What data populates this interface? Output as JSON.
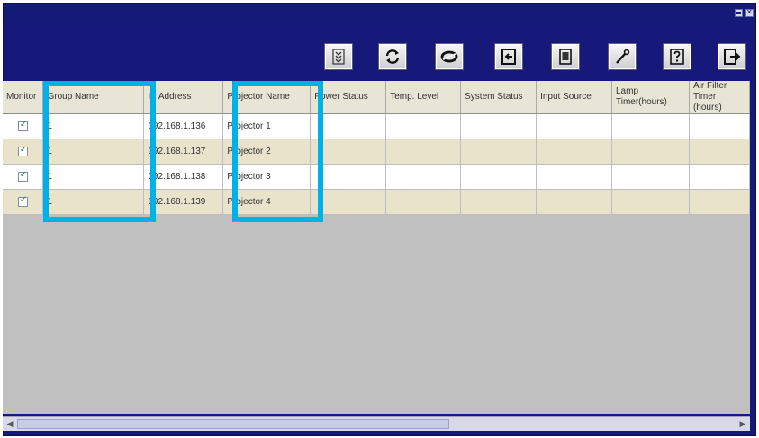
{
  "toolbar": {
    "buttons": [
      {
        "name": "filter-down-icon"
      },
      {
        "name": "refresh-icon"
      },
      {
        "name": "sync-icon"
      },
      {
        "name": "import-icon"
      },
      {
        "name": "save-icon"
      },
      {
        "name": "tool-icon"
      },
      {
        "name": "help-icon"
      },
      {
        "name": "exit-icon"
      }
    ]
  },
  "table": {
    "headers": [
      "Monitor",
      "Group Name",
      "IP Address",
      "Projector Name",
      "Power Status",
      "Temp. Level",
      "System Status",
      "Input Source",
      "Lamp Timer(hours)",
      "Air Filter Timer (hours)"
    ],
    "rows": [
      {
        "monitor": true,
        "group": "1",
        "ip": "192.168.1.136",
        "name": "Projector 1",
        "power": "",
        "temp": "",
        "system": "",
        "input": "",
        "lamp": "",
        "filter": ""
      },
      {
        "monitor": true,
        "group": "1",
        "ip": "192.168.1.137",
        "name": "Projector 2",
        "power": "",
        "temp": "",
        "system": "",
        "input": "",
        "lamp": "",
        "filter": ""
      },
      {
        "monitor": true,
        "group": "1",
        "ip": "192.168.1.138",
        "name": "Projector 3",
        "power": "",
        "temp": "",
        "system": "",
        "input": "",
        "lamp": "",
        "filter": ""
      },
      {
        "monitor": true,
        "group": "1",
        "ip": "192.168.1.139",
        "name": "Projector 4",
        "power": "",
        "temp": "",
        "system": "",
        "input": "",
        "lamp": "",
        "filter": ""
      }
    ]
  },
  "colors": {
    "window": "#141a78",
    "header_bg": "#e8e4d6",
    "alt_row": "#e9e3cc",
    "highlight": "#00b0e8",
    "empty_area": "#c0c0c0"
  }
}
